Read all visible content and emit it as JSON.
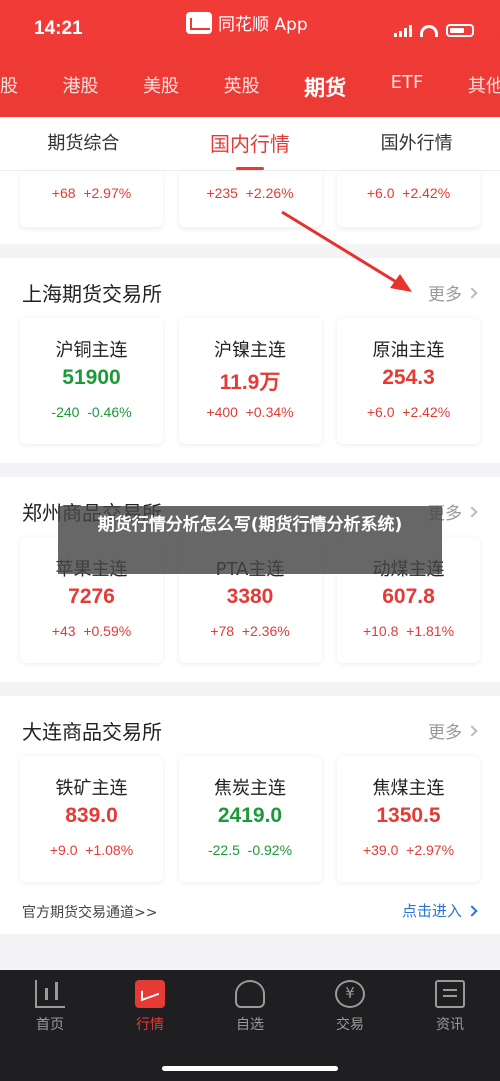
{
  "status": {
    "time": "14:21"
  },
  "app": {
    "title": "同花顺 App"
  },
  "market_tabs": [
    {
      "label": "股",
      "active": false
    },
    {
      "label": "港股",
      "active": false
    },
    {
      "label": "美股",
      "active": false
    },
    {
      "label": "英股",
      "active": false
    },
    {
      "label": "期货",
      "active": true
    },
    {
      "label": "ETF",
      "active": false
    },
    {
      "label": "其他",
      "active": false
    }
  ],
  "subtabs": [
    {
      "label": "期货综合",
      "active": false
    },
    {
      "label": "国内行情",
      "active": true
    },
    {
      "label": "国外行情",
      "active": false
    }
  ],
  "top_partial": [
    {
      "change": "+68",
      "pct": "+2.97%",
      "dir": "up"
    },
    {
      "change": "+235",
      "pct": "+2.26%",
      "dir": "up"
    },
    {
      "change": "+6.0",
      "pct": "+2.42%",
      "dir": "up"
    }
  ],
  "sections": [
    {
      "title": "上海期货交易所",
      "more": "更多",
      "cards": [
        {
          "name": "沪铜主连",
          "price": "51900",
          "change": "-240",
          "pct": "-0.46%",
          "dir": "down"
        },
        {
          "name": "沪镍主连",
          "price": "11.9万",
          "change": "+400",
          "pct": "+0.34%",
          "dir": "up"
        },
        {
          "name": "原油主连",
          "price": "254.3",
          "change": "+6.0",
          "pct": "+2.42%",
          "dir": "up"
        }
      ]
    },
    {
      "title": "郑州商品交易所",
      "more": "更多",
      "cards": [
        {
          "name": "苹果主连",
          "price": "7276",
          "change": "+43",
          "pct": "+0.59%",
          "dir": "up"
        },
        {
          "name": "PTA主连",
          "price": "3380",
          "change": "+78",
          "pct": "+2.36%",
          "dir": "up"
        },
        {
          "name": "动煤主连",
          "price": "607.8",
          "change": "+10.8",
          "pct": "+1.81%",
          "dir": "up"
        }
      ]
    },
    {
      "title": "大连商品交易所",
      "more": "更多",
      "cards": [
        {
          "name": "铁矿主连",
          "price": "839.0",
          "change": "+9.0",
          "pct": "+1.08%",
          "dir": "up"
        },
        {
          "name": "焦炭主连",
          "price": "2419.0",
          "change": "-22.5",
          "pct": "-0.92%",
          "dir": "down"
        },
        {
          "name": "焦煤主连",
          "price": "1350.5",
          "change": "+39.0",
          "pct": "+2.97%",
          "dir": "up"
        }
      ]
    }
  ],
  "footer": {
    "left": "官方期货交易通道>>",
    "right": "点击进入"
  },
  "overlay": {
    "text": "期货行情分析怎么写(期货行情分析系统)"
  },
  "bottom_nav": [
    {
      "label": "首页",
      "icon": "home-chart-icon",
      "active": false
    },
    {
      "label": "行情",
      "icon": "market-chart-icon",
      "active": true
    },
    {
      "label": "自选",
      "icon": "watchlist-person-icon",
      "active": false
    },
    {
      "label": "交易",
      "icon": "yen-coin-icon",
      "active": false
    },
    {
      "label": "资讯",
      "icon": "news-document-icon",
      "active": false
    }
  ],
  "colors": {
    "brand": "#ec3a34",
    "up": "#e63a35",
    "down": "#1c9a3a",
    "link": "#2b75d8"
  }
}
